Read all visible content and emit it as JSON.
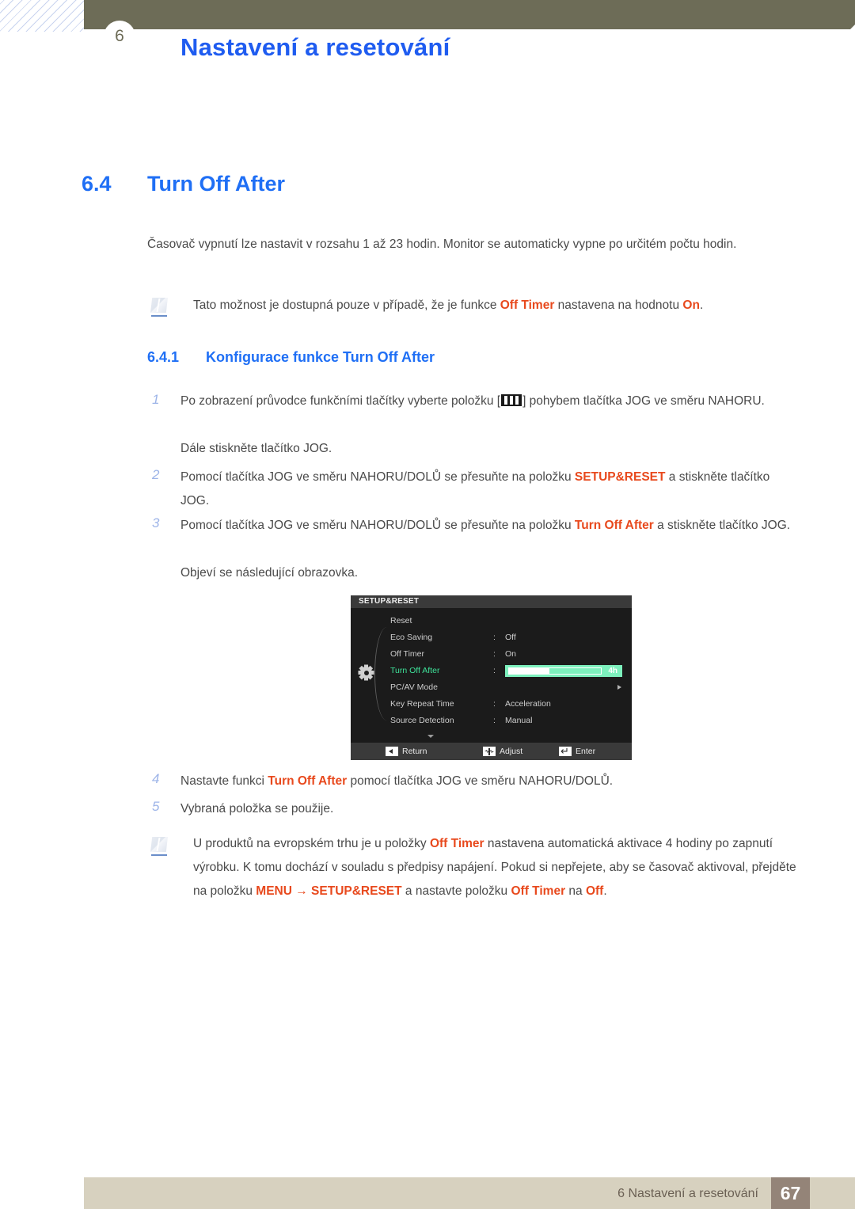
{
  "header": {
    "chapter_number": "6",
    "title": "Nastavení a resetování"
  },
  "section": {
    "number": "6.4",
    "title": "Turn Off After"
  },
  "lead_paragraph": "Časovač vypnutí lze nastavit v rozsahu 1 až 23 hodin. Monitor se automaticky vypne po určitém počtu hodin.",
  "note_top": {
    "text_before": "Tato možnost je dostupná pouze v případě, že je funkce ",
    "highlight_1": "Off Timer",
    "text_mid": " nastavena na hodnotu ",
    "highlight_2": "On",
    "text_after": "."
  },
  "subsection": {
    "number": "6.4.1",
    "title": "Konfigurace funkce Turn Off After"
  },
  "steps": {
    "step1_num": "1",
    "step1_a": "Po zobrazení průvodce funkčními tlačítky vyberte položku [",
    "step1_b": "] pohybem tlačítka JOG ve směru NAHORU.",
    "step1_follow": "Dále stiskněte tlačítko JOG.",
    "step2_num": "2",
    "step2_a": "Pomocí tlačítka JOG ve směru NAHORU/DOLŮ se přesuňte na položku ",
    "step2_hl": "SETUP&RESET",
    "step2_b": " a stiskněte tlačítko JOG.",
    "step3_num": "3",
    "step3_a": "Pomocí tlačítka JOG ve směru NAHORU/DOLŮ se přesuňte na položku ",
    "step3_hl": "Turn Off After",
    "step3_b": " a stiskněte tlačítko JOG.",
    "step3_follow": "Objeví se následující obrazovka.",
    "step4_num": "4",
    "step4_a": "Nastavte funkci ",
    "step4_hl": "Turn Off After",
    "step4_b": " pomocí tlačítka JOG ve směru NAHORU/DOLŮ.",
    "step5_num": "5",
    "step5_text": "Vybraná položka se použije."
  },
  "note_bottom": {
    "t1": "U produktů na evropském trhu je u položky ",
    "h1": "Off Timer",
    "t2": " nastavena automatická aktivace 4 hodiny po zapnutí výrobku. K tomu dochází v souladu s předpisy napájení. Pokud si nepřejete, aby se časovač aktivoval, přejděte na položku ",
    "h2": "MENU",
    "t3": "  →  ",
    "h3": "SETUP&RESET",
    "t4": " a nastavte položku ",
    "h4": "Off Timer",
    "t5": " na ",
    "h5": "Off",
    "t6": "."
  },
  "osd": {
    "title": "SETUP&RESET",
    "rows": [
      {
        "label": "Reset",
        "colon": "",
        "value": ""
      },
      {
        "label": "Eco Saving",
        "colon": ":",
        "value": "Off"
      },
      {
        "label": "Off Timer",
        "colon": ":",
        "value": "On"
      },
      {
        "label": "Turn Off After",
        "colon": ":",
        "value": "4h"
      },
      {
        "label": "PC/AV Mode",
        "colon": "",
        "value": ""
      },
      {
        "label": "Key Repeat Time",
        "colon": ":",
        "value": "Acceleration"
      },
      {
        "label": "Source Detection",
        "colon": ":",
        "value": "Manual"
      }
    ],
    "slider_value": "4h",
    "slider_percent": 44,
    "footer": {
      "return": "Return",
      "adjust": "Adjust",
      "enter": "Enter"
    },
    "accent_color": "#7df0bd",
    "active_label_color": "#3ee39a"
  },
  "footer": {
    "text": "6 Nastavení a resetování",
    "page": "67"
  },
  "colors": {
    "heading_blue": "#1f6ff5",
    "highlight_orange": "#e8491d",
    "header_olive": "#6d6c57",
    "footer_beige": "#d7d1bf",
    "page_box_brown": "#948478"
  }
}
